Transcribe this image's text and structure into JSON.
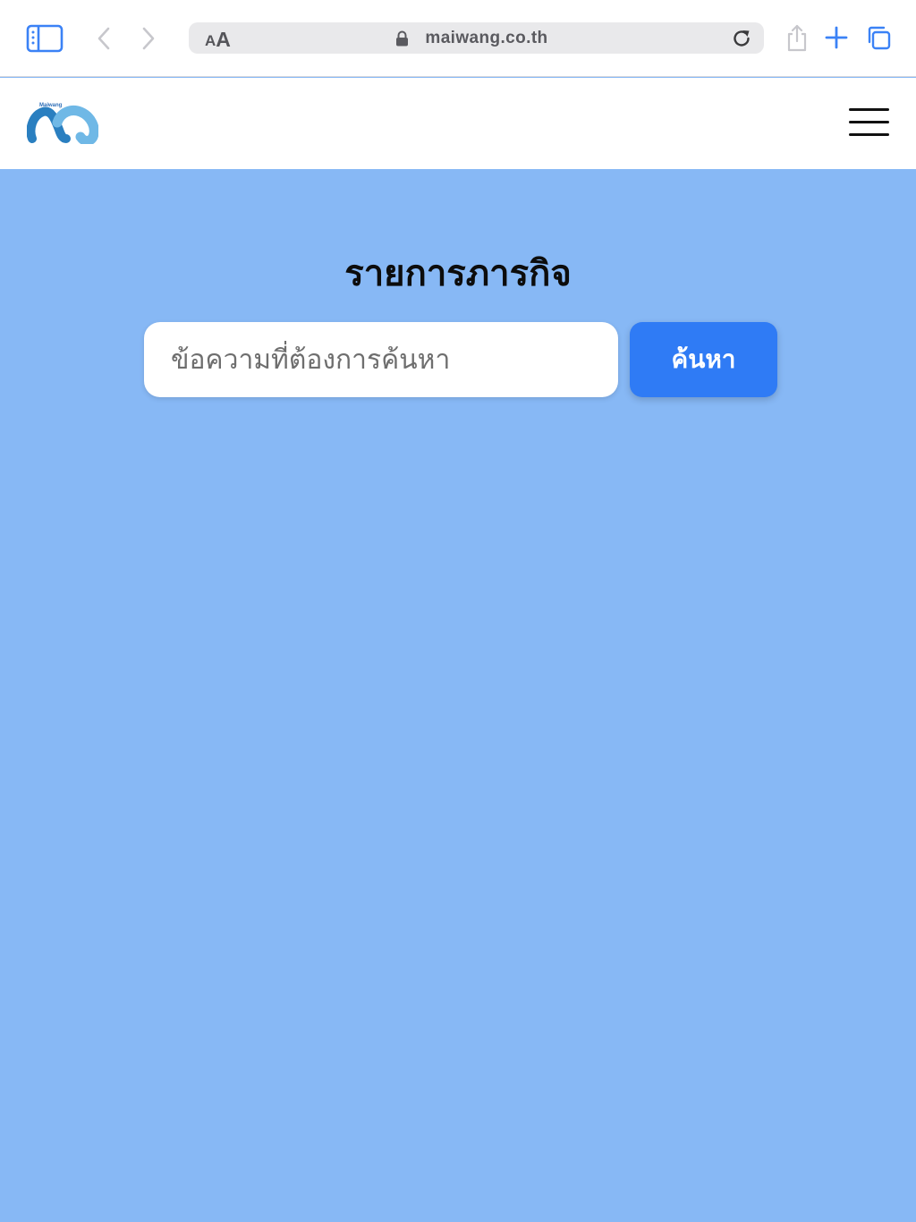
{
  "browser": {
    "text_size_label_small": "A",
    "text_size_label_large": "A",
    "url": "maiwang.co.th",
    "accent_color": "#3b82f6",
    "icons": [
      "sidebar-icon",
      "back-icon",
      "forward-icon",
      "lock-icon",
      "reload-icon",
      "share-icon",
      "new-tab-icon",
      "tabs-icon"
    ]
  },
  "header": {
    "logo_text": "Maiwang",
    "menu_icon": "hamburger-menu-icon"
  },
  "main": {
    "title": "รายการภารกิจ",
    "search": {
      "placeholder": "ข้อความที่ต้องการค้นหา",
      "value": "",
      "button_label": "ค้นหา"
    },
    "background_color": "#87b8f5",
    "button_color": "#2f7bf5"
  }
}
